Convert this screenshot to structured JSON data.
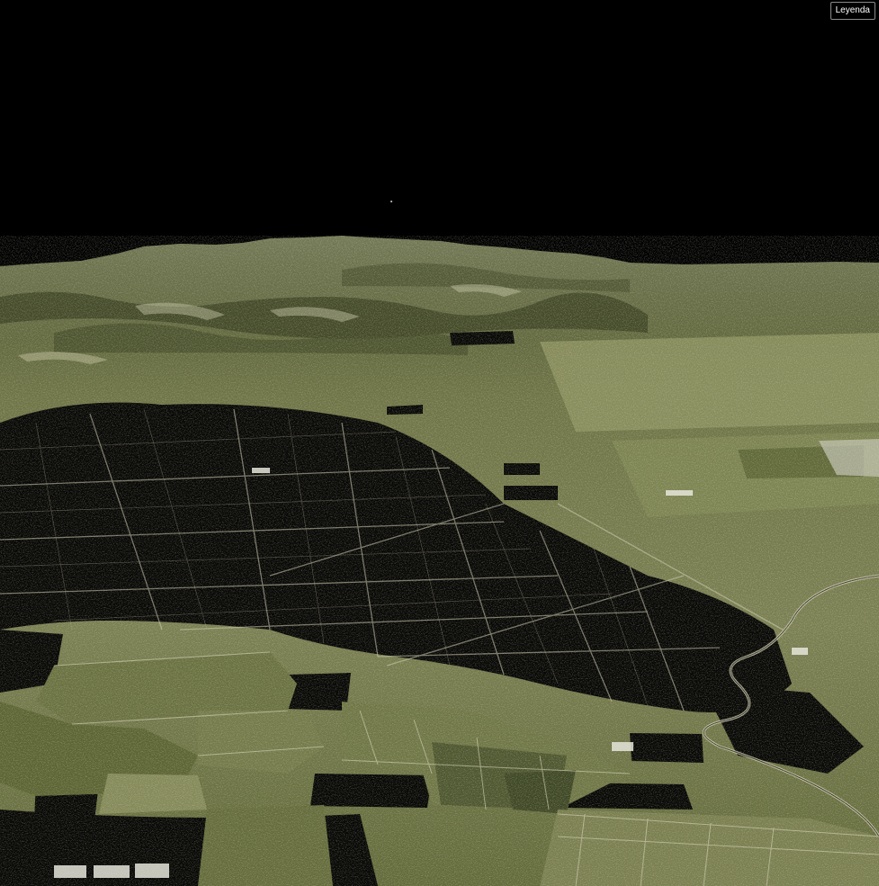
{
  "toolbar": {
    "legend_label": "Leyenda"
  },
  "scene": {
    "view": "3d-terrain-perspective",
    "sky_color": "#000000",
    "terrain_base_color": "#6b7040",
    "terrain_highlight_color": "#c9c8a8",
    "urban_dark_color": "#0a0a08"
  }
}
